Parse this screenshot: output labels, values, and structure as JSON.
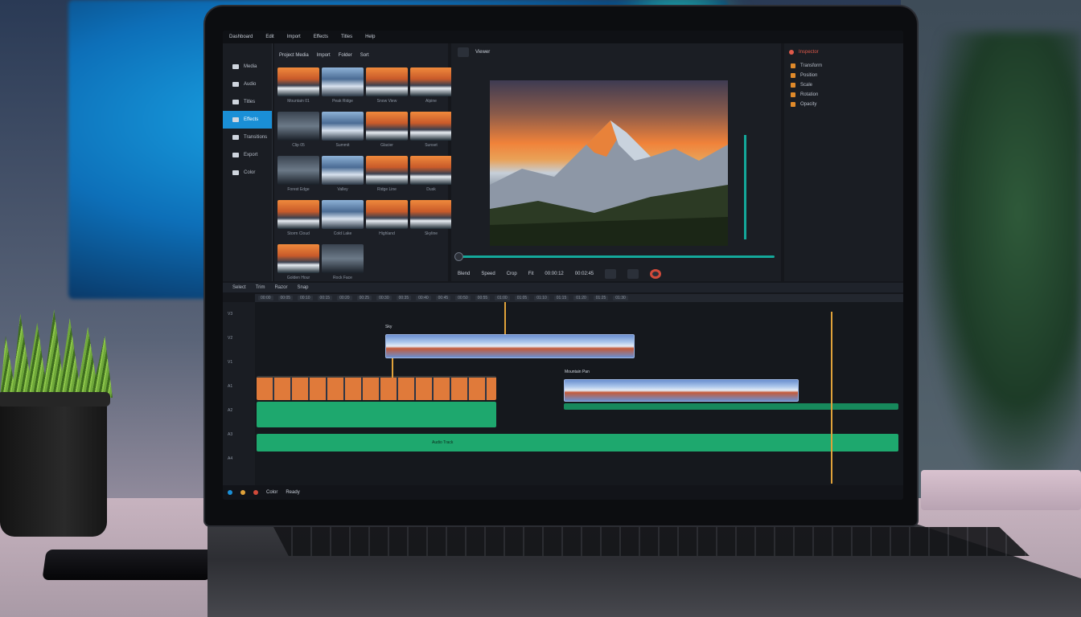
{
  "screen": {
    "menu": [
      "Dashboard",
      "Edit",
      "Import",
      "Effects",
      "Titles",
      "Help"
    ],
    "nav": [
      {
        "label": "Media",
        "icon": "folder-icon"
      },
      {
        "label": "Audio",
        "icon": "music-icon"
      },
      {
        "label": "Titles",
        "icon": "text-icon"
      },
      {
        "label": "Effects",
        "icon": "effects-icon"
      },
      {
        "label": "Transitions",
        "icon": "transition-icon"
      },
      {
        "label": "Export",
        "icon": "export-icon"
      },
      {
        "label": "Color",
        "icon": "palette-icon"
      }
    ],
    "active_nav_index": 3,
    "media": {
      "tabs": [
        "Project Media",
        "Import",
        "Folder",
        "Sort"
      ],
      "thumbs": [
        "Mountain 01",
        "Peak Ridge",
        "Snow View",
        "Alpine",
        "Clip 05",
        "Summit",
        "Glacier",
        "Sunset",
        "Forest Edge",
        "Valley",
        "Ridge Line",
        "Dusk",
        "Storm Cloud",
        "Cold Lake",
        "Highland",
        "Skyline",
        "Golden Hour",
        "Rock Face"
      ]
    },
    "viewer": {
      "title": "Viewer",
      "controls": [
        "Blend",
        "Speed",
        "Crop",
        "Fit"
      ],
      "timecode_left": "00:00:12",
      "timecode_right": "00:02:45"
    },
    "inspector": {
      "title": "Inspector",
      "rows": [
        "Transform",
        "Position",
        "Scale",
        "Rotation",
        "Opacity"
      ]
    },
    "timeline": {
      "toolbar": [
        "Select",
        "Trim",
        "Razor",
        "Snap"
      ],
      "ruler": [
        "00:00",
        "00:05",
        "00:10",
        "00:15",
        "00:20",
        "00:25",
        "00:30",
        "00:35",
        "00:40",
        "00:45",
        "00:50",
        "00:55",
        "01:00",
        "01:05",
        "01:10",
        "01:15",
        "01:20",
        "01:25",
        "01:30"
      ],
      "tracks": [
        "V3",
        "V2",
        "V1",
        "A1",
        "A2",
        "A3",
        "A4"
      ],
      "clip_labels": [
        "Sky",
        "Mountain Pan",
        "Audio Track"
      ]
    },
    "status": {
      "left": "Color",
      "right": "Ready"
    },
    "colors": {
      "accent": "#1a8fd6",
      "audio": "#1ea86e",
      "playhead": "#e0a23a",
      "scrub": "#14a89a"
    }
  }
}
